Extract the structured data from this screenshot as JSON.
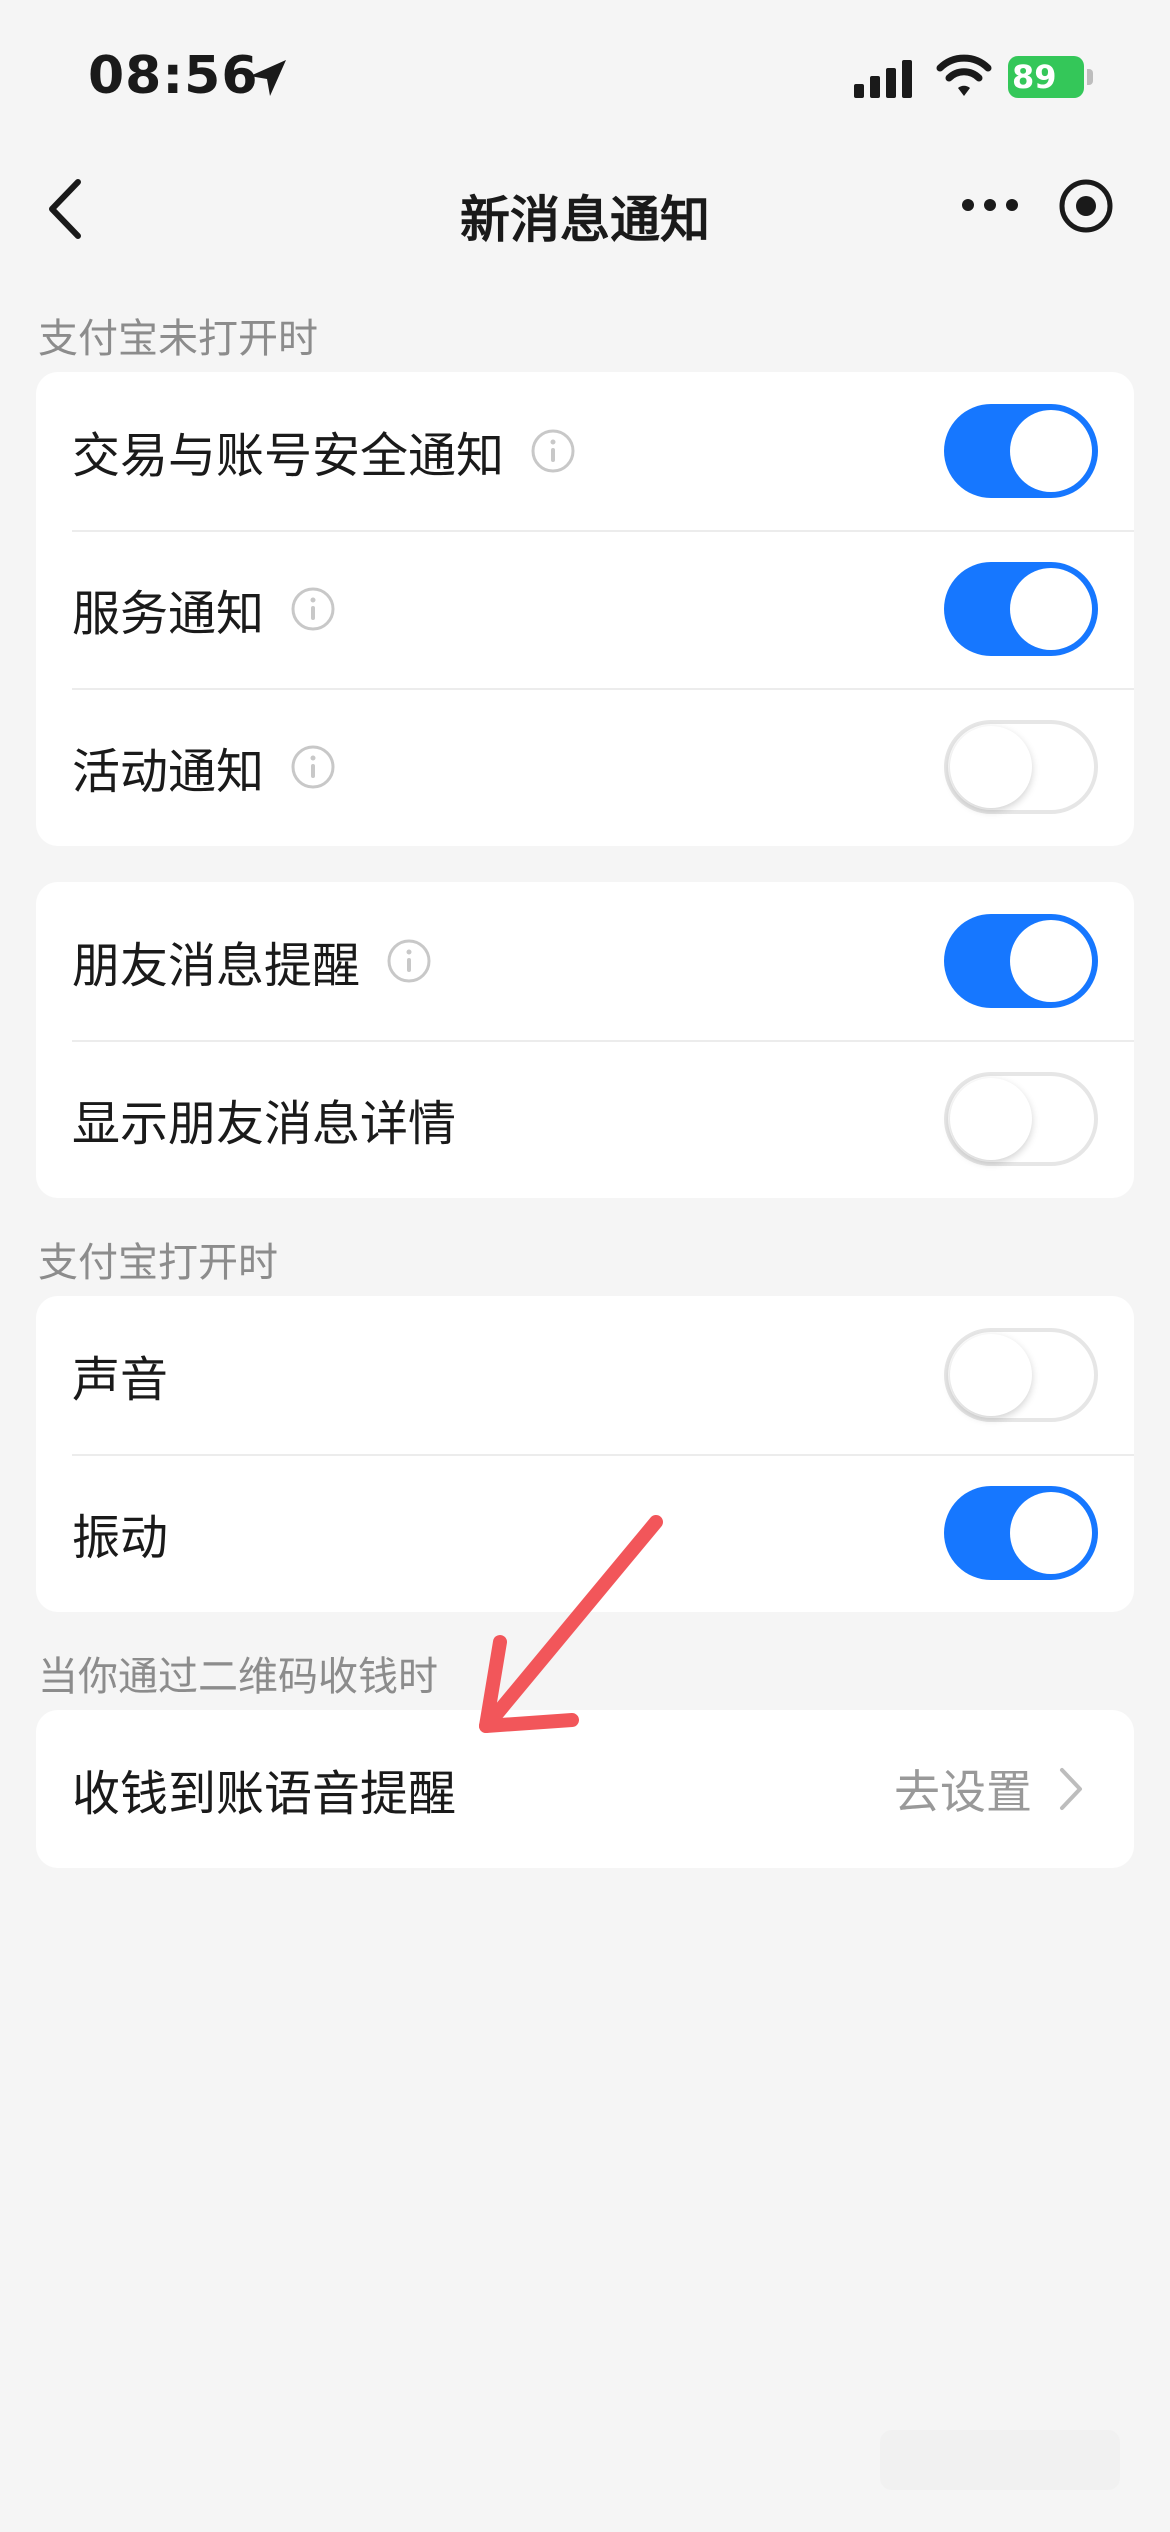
{
  "status_bar": {
    "time": "08:56",
    "battery": "89"
  },
  "nav": {
    "title": "新消息通知"
  },
  "section1": {
    "label": "支付宝未打开时",
    "rows": [
      {
        "label": "交易与账号安全通知",
        "on": true
      },
      {
        "label": "服务通知",
        "on": true
      },
      {
        "label": "活动通知",
        "on": false
      }
    ]
  },
  "section2": {
    "rows": [
      {
        "label": "朋友消息提醒",
        "on": true
      },
      {
        "label": "显示朋友消息详情",
        "on": false
      }
    ]
  },
  "section3": {
    "label": "支付宝打开时",
    "rows": [
      {
        "label": "声音",
        "on": false
      },
      {
        "label": "振动",
        "on": true
      }
    ]
  },
  "section4": {
    "label": "当你通过二维码收钱时",
    "row": {
      "label": "收钱到账语音提醒",
      "value": "去设置"
    }
  },
  "colors": {
    "accent": "#1677ff",
    "annotation_arrow": "#f2565a",
    "battery": "#34c759"
  },
  "icons": [
    "location-arrow-icon",
    "signal-icon",
    "wifi-icon",
    "back-arrow-icon",
    "more-icon",
    "target-icon",
    "info-icon",
    "chevron-right-icon"
  ]
}
